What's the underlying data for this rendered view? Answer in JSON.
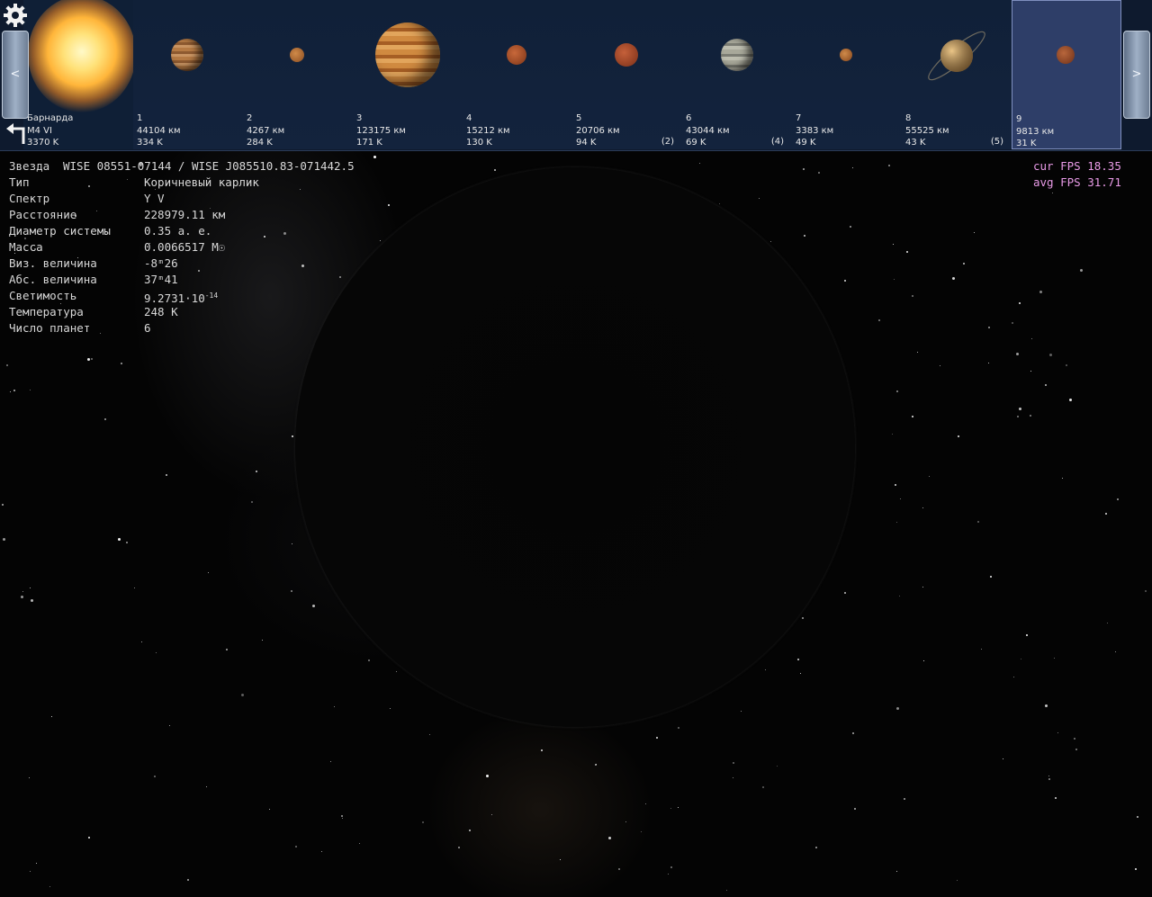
{
  "window": {
    "toolbar": {
      "settings_icon": "gear-icon",
      "back_icon": "return-arrow-icon",
      "prev_label": "<",
      "next_label": ">"
    }
  },
  "bodies": [
    {
      "name": "Барнарда",
      "line2": "M4 VI",
      "line3": "3370 K",
      "moons": "",
      "kind": "star"
    },
    {
      "name": "1",
      "line2": "44104 км",
      "line3": "334 K",
      "moons": "",
      "kind": "jupiter-small"
    },
    {
      "name": "2",
      "line2": "4267 км",
      "line3": "284 K",
      "moons": "",
      "kind": "rock-tiny"
    },
    {
      "name": "3",
      "line2": "123175 км",
      "line3": "171 K",
      "moons": "",
      "kind": "jupiter-large"
    },
    {
      "name": "4",
      "line2": "15212 км",
      "line3": "130 K",
      "moons": "",
      "kind": "rock-small"
    },
    {
      "name": "5",
      "line2": "20706 км",
      "line3": "94 K",
      "moons": "(2)",
      "kind": "rock-medium"
    },
    {
      "name": "6",
      "line2": "43044 км",
      "line3": "69 K",
      "moons": "(4)",
      "kind": "neptune"
    },
    {
      "name": "7",
      "line2": "3383 км",
      "line3": "49 K",
      "moons": "",
      "kind": "rock-tiny"
    },
    {
      "name": "8",
      "line2": "55525 км",
      "line3": "43 K",
      "moons": "(5)",
      "kind": "saturn"
    },
    {
      "name": "9",
      "line2": "9813 км",
      "line3": "31 K",
      "moons": "",
      "kind": "rock-small",
      "selected": true
    }
  ],
  "info": {
    "star_label": "Звезда",
    "star_value": "WISE 08551-07144 / WISE J085510.83-071442.5",
    "type_label": "Тип",
    "type_value": "Коричневый карлик",
    "spectrum_label": "Спектр",
    "spectrum_value": "Y V",
    "distance_label": "Расстояние",
    "distance_value": "228979.11 км",
    "diameter_label": "Диаметр системы",
    "diameter_value": "0.35 а. е.",
    "mass_label": "Масса",
    "mass_value": "0.0066517 M☉",
    "vismag_label": "Виз. величина",
    "vismag_value": "-8ᵐ26",
    "absmag_label": "Абс. величина",
    "absmag_value": "37ᵐ41",
    "lum_label": "Светимость",
    "lum_value": "9.2731·10",
    "lum_exp": "-14",
    "temp_label": "Температура",
    "temp_value": "248 K",
    "planets_label": "Число планет",
    "planets_value": "6"
  },
  "fps": {
    "cur_label": "cur FPS",
    "cur_value": "18.35",
    "avg_label": "avg FPS",
    "avg_value": "31.71"
  },
  "colors": {
    "info_text": "#d8d8d8",
    "fps_text": "#e89ae6",
    "strip_bg": "#102038",
    "selected_card": "#2e3e68"
  }
}
